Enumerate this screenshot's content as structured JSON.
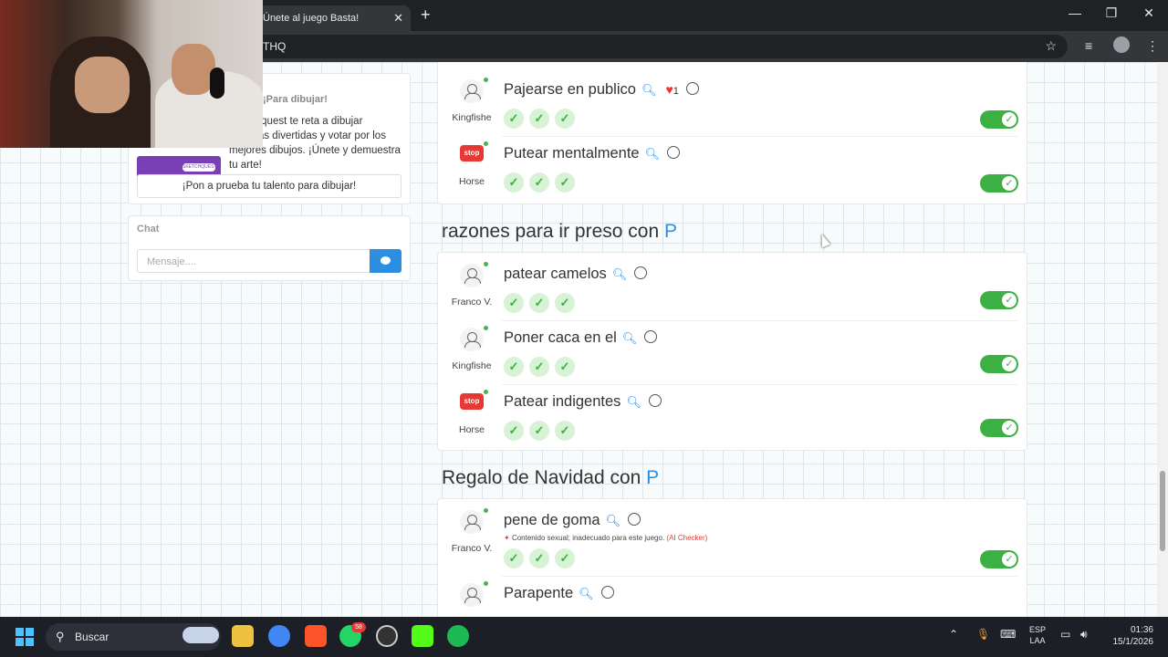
{
  "browser": {
    "tab_title": "Únete al juego Basta!",
    "tab_close": "✕",
    "new_tab": "+",
    "url": "THQ",
    "window_controls": {
      "minimize": "—",
      "maximize": "❐",
      "close": "✕"
    }
  },
  "sidebar": {
    "promo": {
      "title": "¡Para dibujar!",
      "text": "Sketchquest te reta a dibujar palabras divertidas y votar por los mejores dibujos. ¡Únete y demuestra tu arte!",
      "badge": "SKETCHQUEST",
      "button": "¡Pon a prueba tu talento para dibujar!"
    },
    "chat": {
      "title": "Chat",
      "placeholder": "Mensaje...."
    }
  },
  "categories": [
    {
      "title": "",
      "letter": "",
      "rows": [
        {
          "user": "Kingfishe",
          "avatar": "user-icon",
          "answer": "Pajearse en publico",
          "likes": "1",
          "checks": [
            "✓",
            "✓",
            "✓"
          ]
        },
        {
          "user": "Horse",
          "avatar": "stop-badge",
          "answer": "Putear mentalmente",
          "checks": [
            "✓",
            "✓",
            "✓"
          ]
        }
      ]
    },
    {
      "title": "razones para ir preso con",
      "letter": "P",
      "rows": [
        {
          "user": "Franco V.",
          "avatar": "user-star-icon",
          "answer": "patear camelos",
          "checks": [
            "✓",
            "✓",
            "✓"
          ]
        },
        {
          "user": "Kingfishe",
          "avatar": "user-icon",
          "answer": "Poner caca en el",
          "checks": [
            "✓",
            "✓",
            "✓"
          ]
        },
        {
          "user": "Horse",
          "avatar": "stop-badge",
          "answer": "Patear indigentes",
          "checks": [
            "✓",
            "✓",
            "✓"
          ]
        }
      ]
    },
    {
      "title": "Regalo de Navidad con",
      "letter": "P",
      "rows": [
        {
          "user": "Franco V.",
          "avatar": "user-star-icon",
          "answer": "pene de goma",
          "flag": "Contenido sexual; inadecuado para este juego.",
          "flag_source": "(AI Checker)",
          "checks": [
            "✓",
            "✓",
            "✓"
          ]
        },
        {
          "user": "",
          "avatar": "user-icon",
          "answer": "Parapente",
          "checks": []
        }
      ]
    }
  ],
  "stop_label": "stop",
  "taskbar": {
    "search": "Buscar",
    "whatsapp_badge": "58",
    "lang_line1": "ESP",
    "lang_line2": "LAA",
    "time": "01:36",
    "date": "15/1/2026"
  },
  "colors": {
    "accent": "#2d8de0",
    "toggle_on": "#3cb043",
    "danger": "#e53935"
  }
}
